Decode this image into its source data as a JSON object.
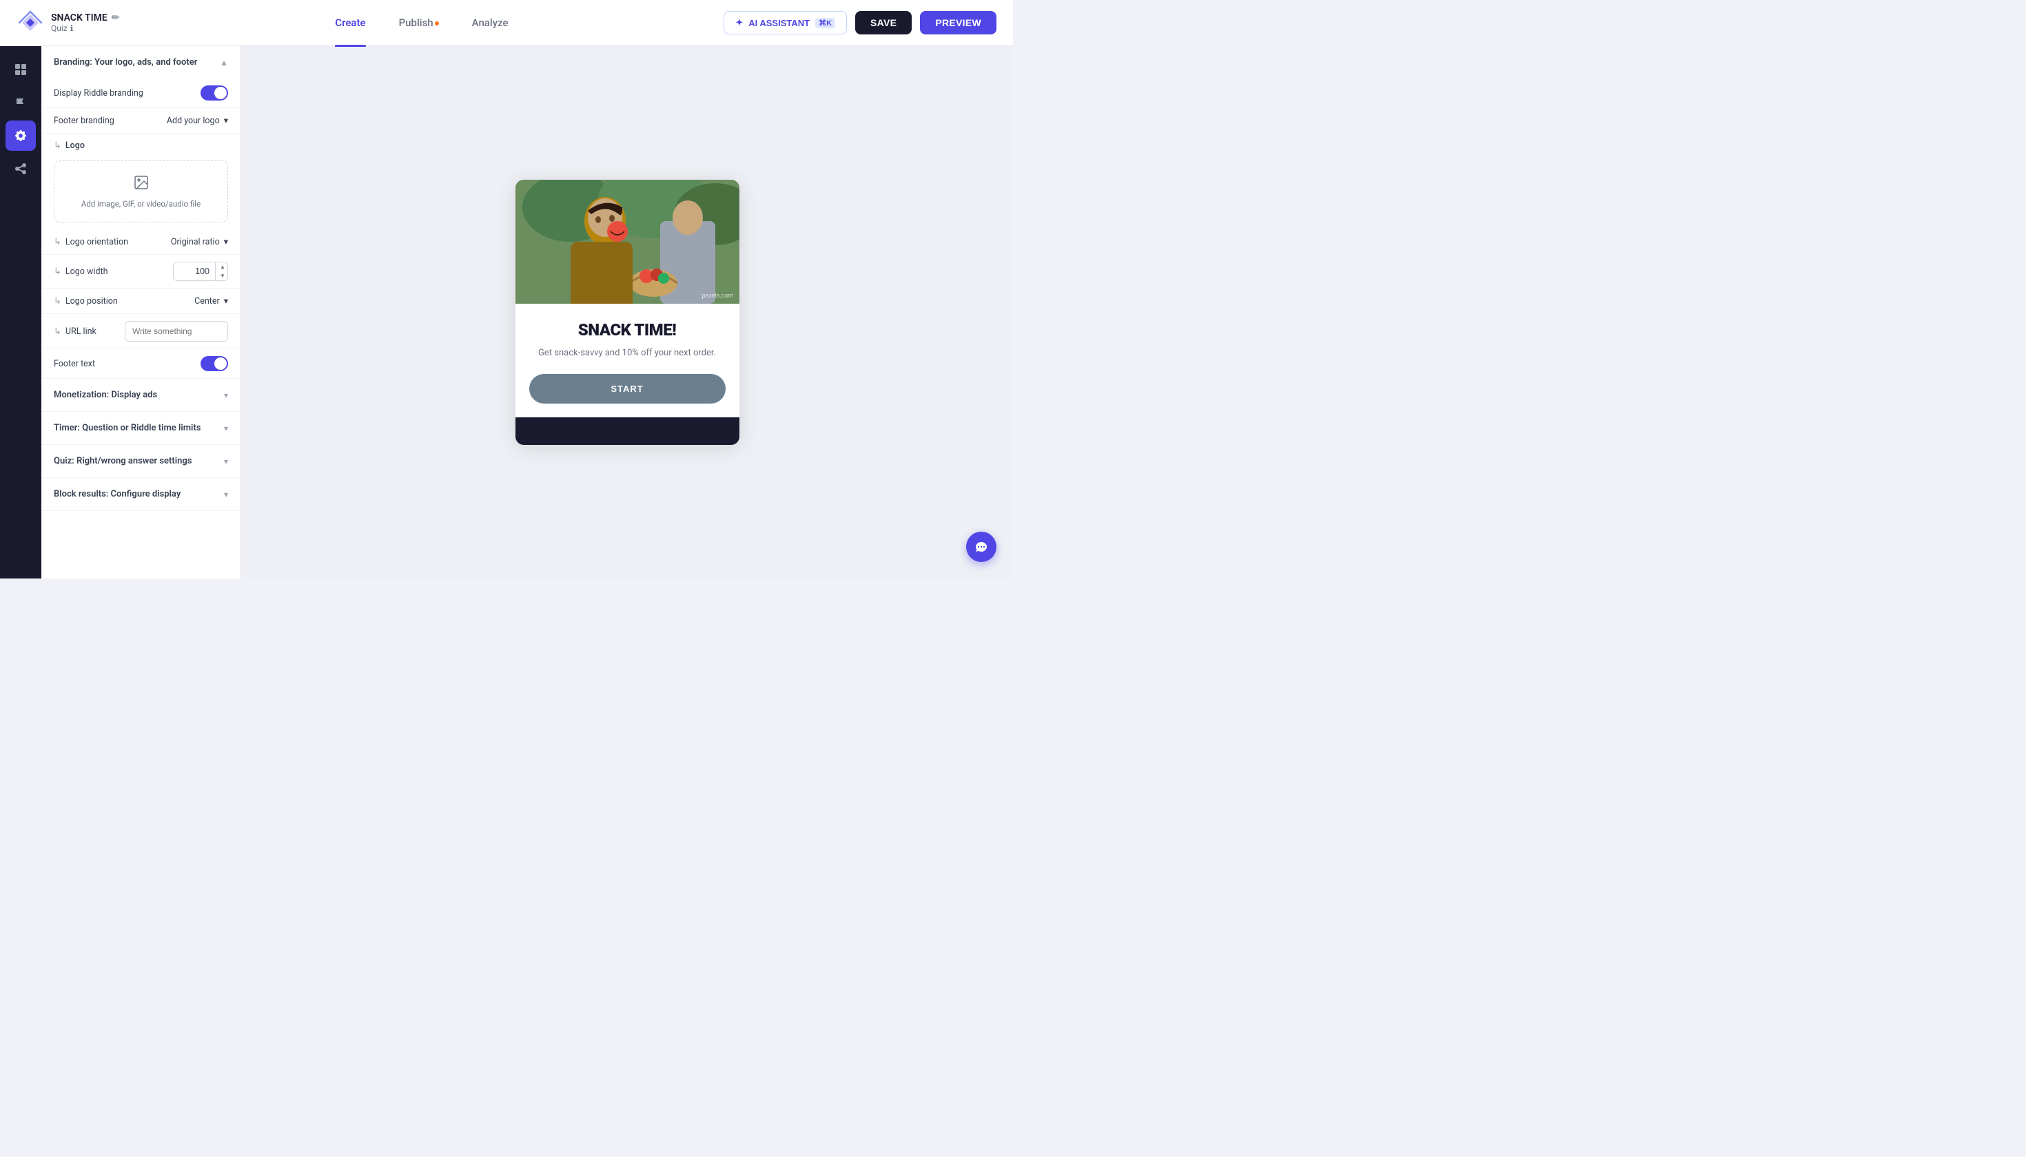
{
  "app": {
    "title": "SNACK TIME",
    "edit_icon": "✏",
    "subtitle": "Quiz",
    "info_icon": "ℹ"
  },
  "nav": {
    "create_label": "Create",
    "publish_label": "Publish",
    "publish_dot": true,
    "analyze_label": "Analyze",
    "active_tab": "create"
  },
  "toolbar": {
    "ai_label": "AI ASSISTANT",
    "ai_shortcut": "⌘K",
    "save_label": "SAVE",
    "preview_label": "PREVIEW"
  },
  "sidebar_icons": [
    {
      "id": "grid",
      "icon": "⊞",
      "active": false
    },
    {
      "id": "flag",
      "icon": "⚑",
      "active": false
    },
    {
      "id": "gear",
      "icon": "⚙",
      "active": true
    },
    {
      "id": "share",
      "icon": "↗",
      "active": false
    }
  ],
  "settings": {
    "branding_header": "Branding: Your logo, ads, and footer",
    "display_riddle_label": "Display Riddle branding",
    "display_riddle_on": true,
    "footer_branding_label": "Footer branding",
    "footer_branding_value": "Add your logo",
    "logo_label": "Logo",
    "upload_label": "Add image, GIF, or video/audio file",
    "logo_orientation_label": "Logo orientation",
    "logo_orientation_value": "Original ratio",
    "logo_width_label": "Logo width",
    "logo_width_value": "100",
    "logo_position_label": "Logo position",
    "logo_position_value": "Center",
    "url_link_label": "URL link",
    "url_link_placeholder": "Write something",
    "footer_text_label": "Footer text",
    "footer_text_on": true,
    "monetization_label": "Monetization: Display ads",
    "timer_label": "Timer: Question or Riddle time limits",
    "quiz_settings_label": "Quiz: Right/wrong answer settings",
    "block_results_label": "Block results: Configure display"
  },
  "preview": {
    "quiz_title": "SNACK TIME!",
    "quiz_subtitle": "Get snack-savvy and 10% off your next order.",
    "start_label": "START",
    "pexels_badge": "pexels.com"
  }
}
